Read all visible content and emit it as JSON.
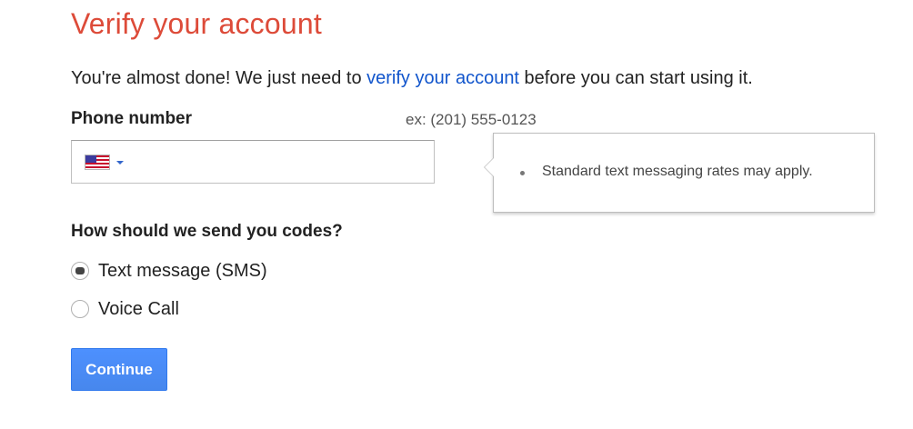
{
  "page": {
    "title": "Verify your account",
    "intro": {
      "before": "You're almost done! We just need to ",
      "link": "verify your account",
      "after": " before you can start using it."
    }
  },
  "phone": {
    "label": "Phone number",
    "example": "ex: (201) 555-0123",
    "value": "",
    "country_icon": "us-flag-icon"
  },
  "tooltip": {
    "items": [
      "Standard text messaging rates may apply."
    ]
  },
  "codes": {
    "label": "How should we send you codes?",
    "options": [
      {
        "label": "Text message (SMS)",
        "selected": true
      },
      {
        "label": "Voice Call",
        "selected": false
      }
    ]
  },
  "actions": {
    "continue_label": "Continue"
  },
  "colors": {
    "title": "#dd4b39",
    "link": "#1155cc",
    "button": "#4d90fe"
  }
}
